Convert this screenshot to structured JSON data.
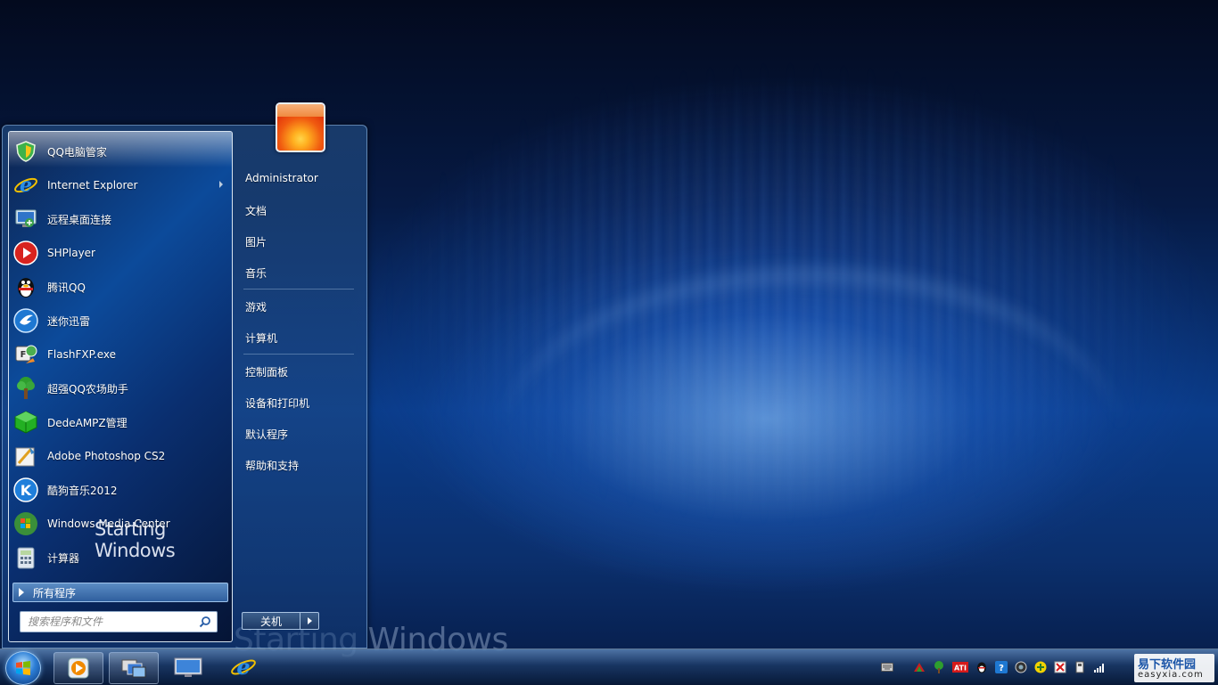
{
  "start_menu": {
    "programs": [
      {
        "label": "QQ电脑管家",
        "icon": "qq-pc-manager-icon"
      },
      {
        "label": "Internet Explorer",
        "icon": "internet-explorer-icon",
        "has_submenu": true
      },
      {
        "label": "远程桌面连接",
        "icon": "remote-desktop-icon"
      },
      {
        "label": "SHPlayer",
        "icon": "shplayer-icon"
      },
      {
        "label": "腾讯QQ",
        "icon": "qq-penguin-icon"
      },
      {
        "label": "迷你迅雷",
        "icon": "thunder-icon"
      },
      {
        "label": "FlashFXP.exe",
        "icon": "flashfxp-icon"
      },
      {
        "label": "超强QQ农场助手",
        "icon": "farm-tree-icon"
      },
      {
        "label": "DedeAMPZ管理",
        "icon": "dedeampz-cube-icon"
      },
      {
        "label": "Adobe Photoshop CS2",
        "icon": "photoshop-icon"
      },
      {
        "label": "酷狗音乐2012",
        "icon": "kugou-icon"
      },
      {
        "label": "Windows Media Center",
        "icon": "media-center-icon"
      },
      {
        "label": "计算器",
        "icon": "calculator-icon"
      }
    ],
    "overlay_text": "Starting Windows",
    "all_programs": "所有程序",
    "search_placeholder": "搜索程序和文件",
    "right_items": {
      "user": "Administrator",
      "documents": "文档",
      "pictures": "图片",
      "music": "音乐",
      "games": "游戏",
      "computer": "计算机",
      "control_panel": "控制面板",
      "devices_printers": "设备和打印机",
      "default_programs": "默认程序",
      "help_support": "帮助和支持"
    },
    "shutdown": "关机"
  },
  "desktop": {
    "watermark_text": "Starting Windows"
  },
  "taskbar": {
    "pinned": [
      "media-player-icon",
      "window-switcher-icon",
      "show-desktop-icon",
      "internet-explorer-icon"
    ],
    "tray_icons": [
      "keyboard-icon",
      "network-icon",
      "tree-icon",
      "ati-icon",
      "qq-icon",
      "help-icon",
      "camera-icon",
      "plus-icon",
      "flag-icon",
      "usb-icon",
      "signal-icon"
    ],
    "logo_line1": "易下软件园",
    "logo_line2": "easyxia.com"
  },
  "colors": {
    "desktop_bg": "#0a3c8a",
    "menu_border": "#d8e4f0",
    "accent": "#2c7ed6"
  }
}
